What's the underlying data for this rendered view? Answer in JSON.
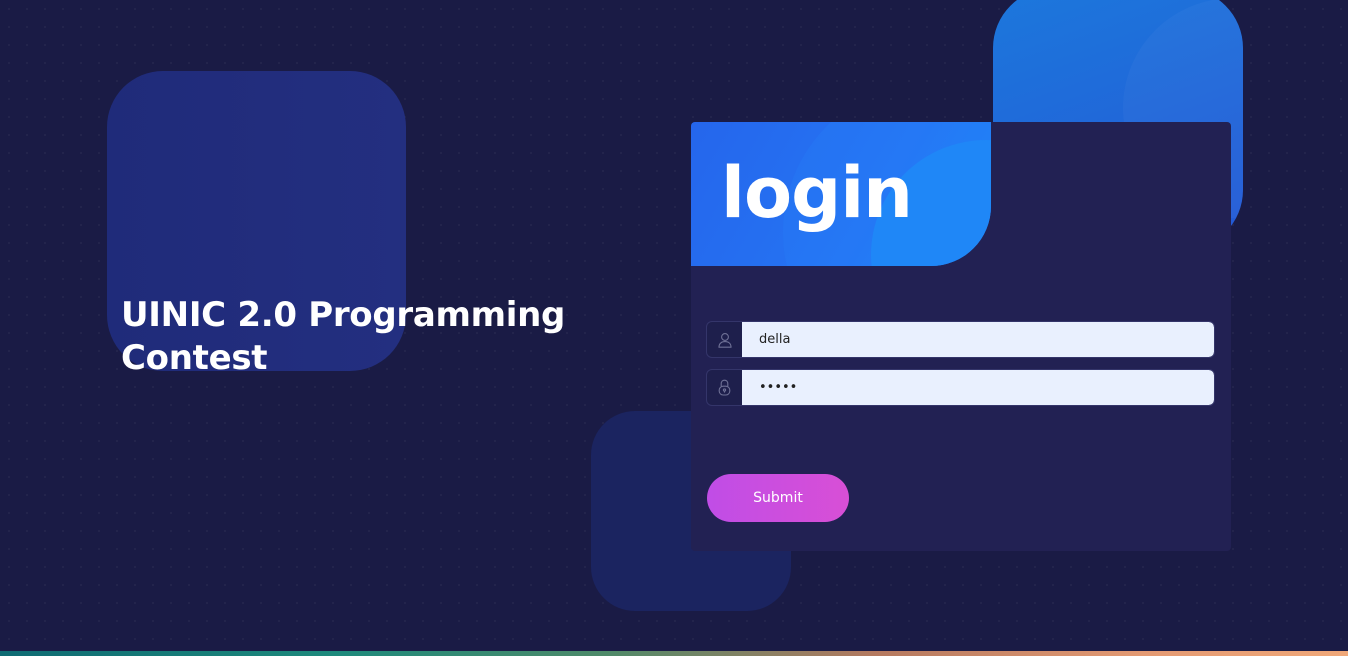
{
  "page": {
    "contest_title": "UINIC 2.0 Programming Contest"
  },
  "login": {
    "title": "login",
    "username": {
      "icon": "user-icon",
      "value": "della"
    },
    "password": {
      "icon": "lock-icon",
      "value": "della"
    },
    "submit_label": "Submit"
  },
  "colors": {
    "background": "#1a1b45",
    "card": "#222153",
    "header_blue": "#2574f3",
    "input_bg": "#e9f0fe",
    "submit_gradient_start": "#c04de6",
    "submit_gradient_end": "#d84fd6"
  }
}
